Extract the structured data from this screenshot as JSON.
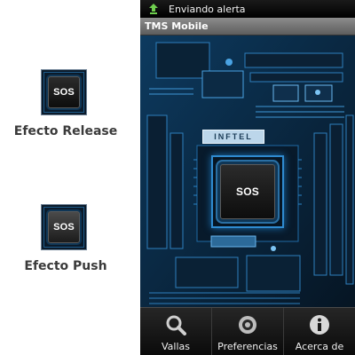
{
  "left_panel": {
    "release": {
      "button_label": "SOS",
      "caption": "Efecto Release"
    },
    "push": {
      "button_label": "SOS",
      "caption": "Efecto Push"
    }
  },
  "phone": {
    "status_bar": {
      "icon": "upload-arrow-icon",
      "text": "Enviando alerta"
    },
    "title_bar": {
      "title": "TMS Mobile"
    },
    "content": {
      "board_label": "INFTEL",
      "sos_button_label": "SOS"
    },
    "nav": [
      {
        "label": "Vallas",
        "icon": "magnifier-icon"
      },
      {
        "label": "Preferencias",
        "icon": "settings-icon"
      },
      {
        "label": "Acerca de",
        "icon": "info-icon"
      }
    ],
    "colors": {
      "accent": "#2f8bd0",
      "board": "#061523"
    }
  }
}
